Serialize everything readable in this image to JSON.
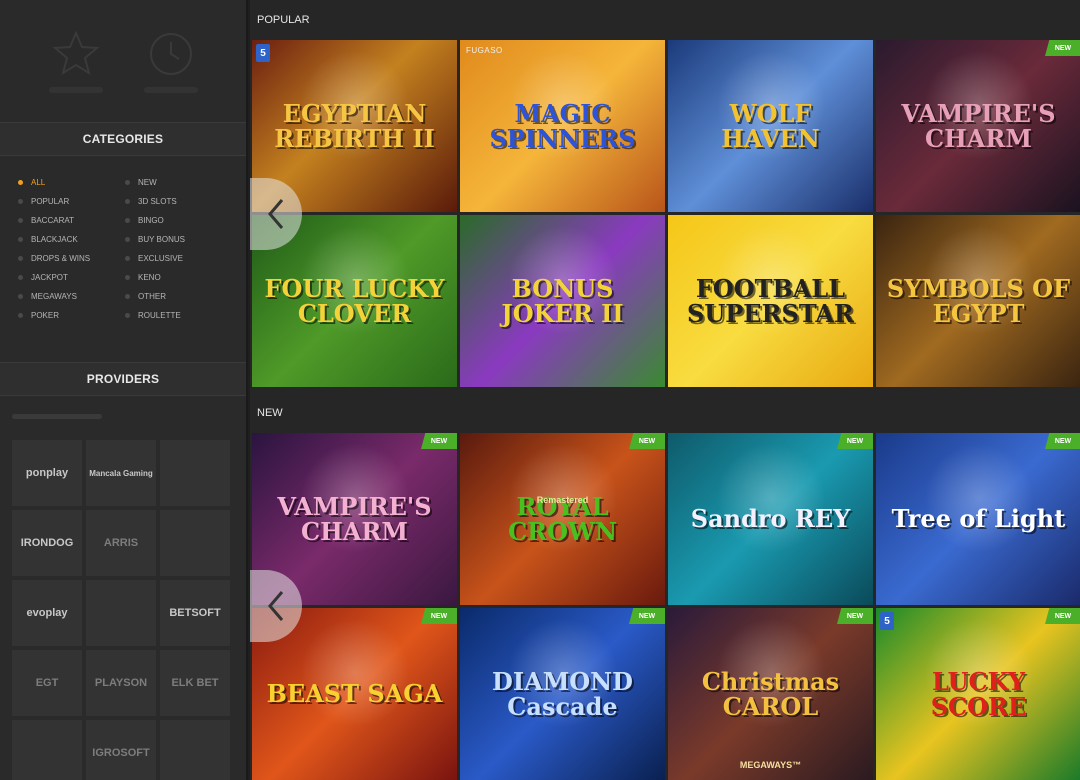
{
  "sidebar": {
    "categories_title": "CATEGORIES",
    "providers_title": "PROVIDERS",
    "categories": [
      {
        "label": "ALL",
        "active": true
      },
      {
        "label": "NEW",
        "active": false
      },
      {
        "label": "POPULAR",
        "active": false
      },
      {
        "label": "3D SLOTS",
        "active": false
      },
      {
        "label": "BACCARAT",
        "active": false
      },
      {
        "label": "BINGO",
        "active": false
      },
      {
        "label": "BLACKJACK",
        "active": false
      },
      {
        "label": "BUY BONUS",
        "active": false
      },
      {
        "label": "DROPS & WINS",
        "active": false
      },
      {
        "label": "EXCLUSIVE",
        "active": false
      },
      {
        "label": "JACKPOT",
        "active": false
      },
      {
        "label": "KENO",
        "active": false
      },
      {
        "label": "MEGAWAYS",
        "active": false
      },
      {
        "label": "OTHER",
        "active": false
      },
      {
        "label": "POKER",
        "active": false
      },
      {
        "label": "ROULETTE",
        "active": false
      }
    ],
    "providers": [
      "ponplay",
      "Mancala Gaming",
      "",
      "IRONDOG",
      "ARRIS",
      "",
      "evoplay",
      "",
      "BETSOFT",
      "EGT",
      "PLAYSON",
      "ELK BET",
      "",
      "IGROSOFT",
      ""
    ]
  },
  "sections": [
    {
      "title": "POPULAR",
      "games": [
        {
          "title": "EGYPTIAN REBIRTH II",
          "badge": "5",
          "new": false
        },
        {
          "title": "MAGIC SPINNERS",
          "provider": "FUGASO",
          "new": false
        },
        {
          "title": "WOLF HAVEN",
          "new": false
        },
        {
          "title": "VAMPIRE'S CHARM",
          "new": true
        },
        {
          "title": "FOUR LUCKY CLOVER",
          "new": false
        },
        {
          "title": "BONUS JOKER II",
          "new": false
        },
        {
          "title": "FOOTBALL SUPERSTAR",
          "new": false
        },
        {
          "title": "SYMBOLS OF EGYPT",
          "new": false
        }
      ]
    },
    {
      "title": "NEW",
      "games": [
        {
          "title": "VAMPIRE'S CHARM",
          "new": true
        },
        {
          "title": "ROYAL CROWN",
          "sub": "Remastered",
          "new": true
        },
        {
          "title": "Sandro REY",
          "new": true
        },
        {
          "title": "Tree of Light",
          "new": true
        },
        {
          "title": "BEAST SAGA",
          "new": true
        },
        {
          "title": "DIAMOND Cascade",
          "new": true
        },
        {
          "title": "Christmas CAROL",
          "sub": "MEGAWAYS™",
          "new": true
        },
        {
          "title": "LUCKY SCORE",
          "badge": "5",
          "new": true
        }
      ]
    }
  ],
  "badge_new_label": "NEW",
  "colors": {
    "accent": "#f0a020",
    "new_badge": "#4caf2a"
  }
}
